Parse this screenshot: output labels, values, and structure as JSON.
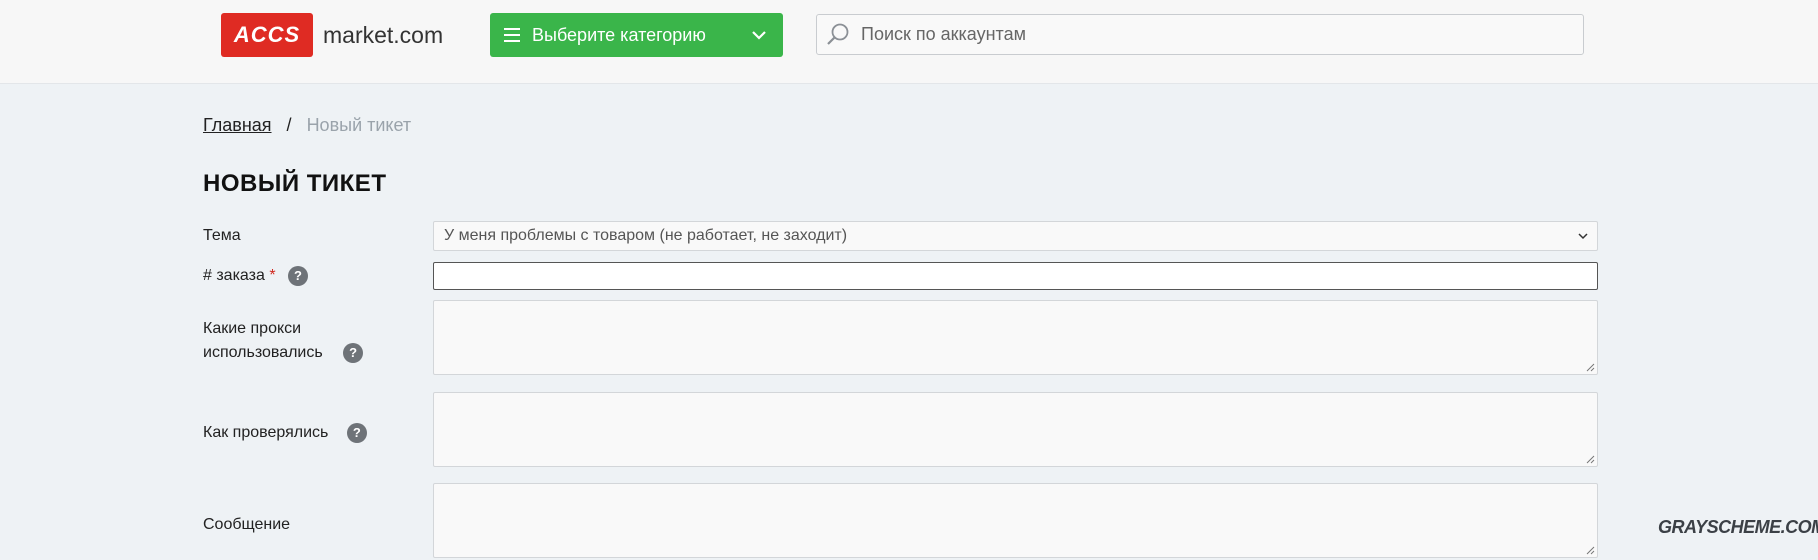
{
  "header": {
    "logo_badge": "ACCS",
    "logo_domain": "market.com",
    "category_button_label": "Выберите категорию",
    "search_placeholder": "Поиск по аккаунтам"
  },
  "breadcrumb": {
    "home": "Главная",
    "separator": "/",
    "current": "Новый тикет"
  },
  "page_title": "НОВЫЙ ТИКЕТ",
  "form": {
    "topic_label": "Тема",
    "topic_value": "У меня проблемы с товаром (не работает, не заходит)",
    "order_label": "# заказа",
    "order_required_mark": "*",
    "order_value": "",
    "proxies_label_line1": "Какие прокси",
    "proxies_label_line2": "использовались",
    "checked_label": "Как проверялись",
    "message_label": "Сообщение",
    "help_glyph": "?"
  },
  "watermark": "GRAYSCHEME.COM",
  "colors": {
    "brand_red": "#df2b23",
    "category_green": "#3ab54a",
    "page_bg": "#eef2f5",
    "required_red": "#d0271d"
  },
  "icons": [
    "burger-icon",
    "chevron-down-icon",
    "search-icon",
    "help-icon",
    "select-arrow-icon",
    "resize-grip-icon"
  ]
}
